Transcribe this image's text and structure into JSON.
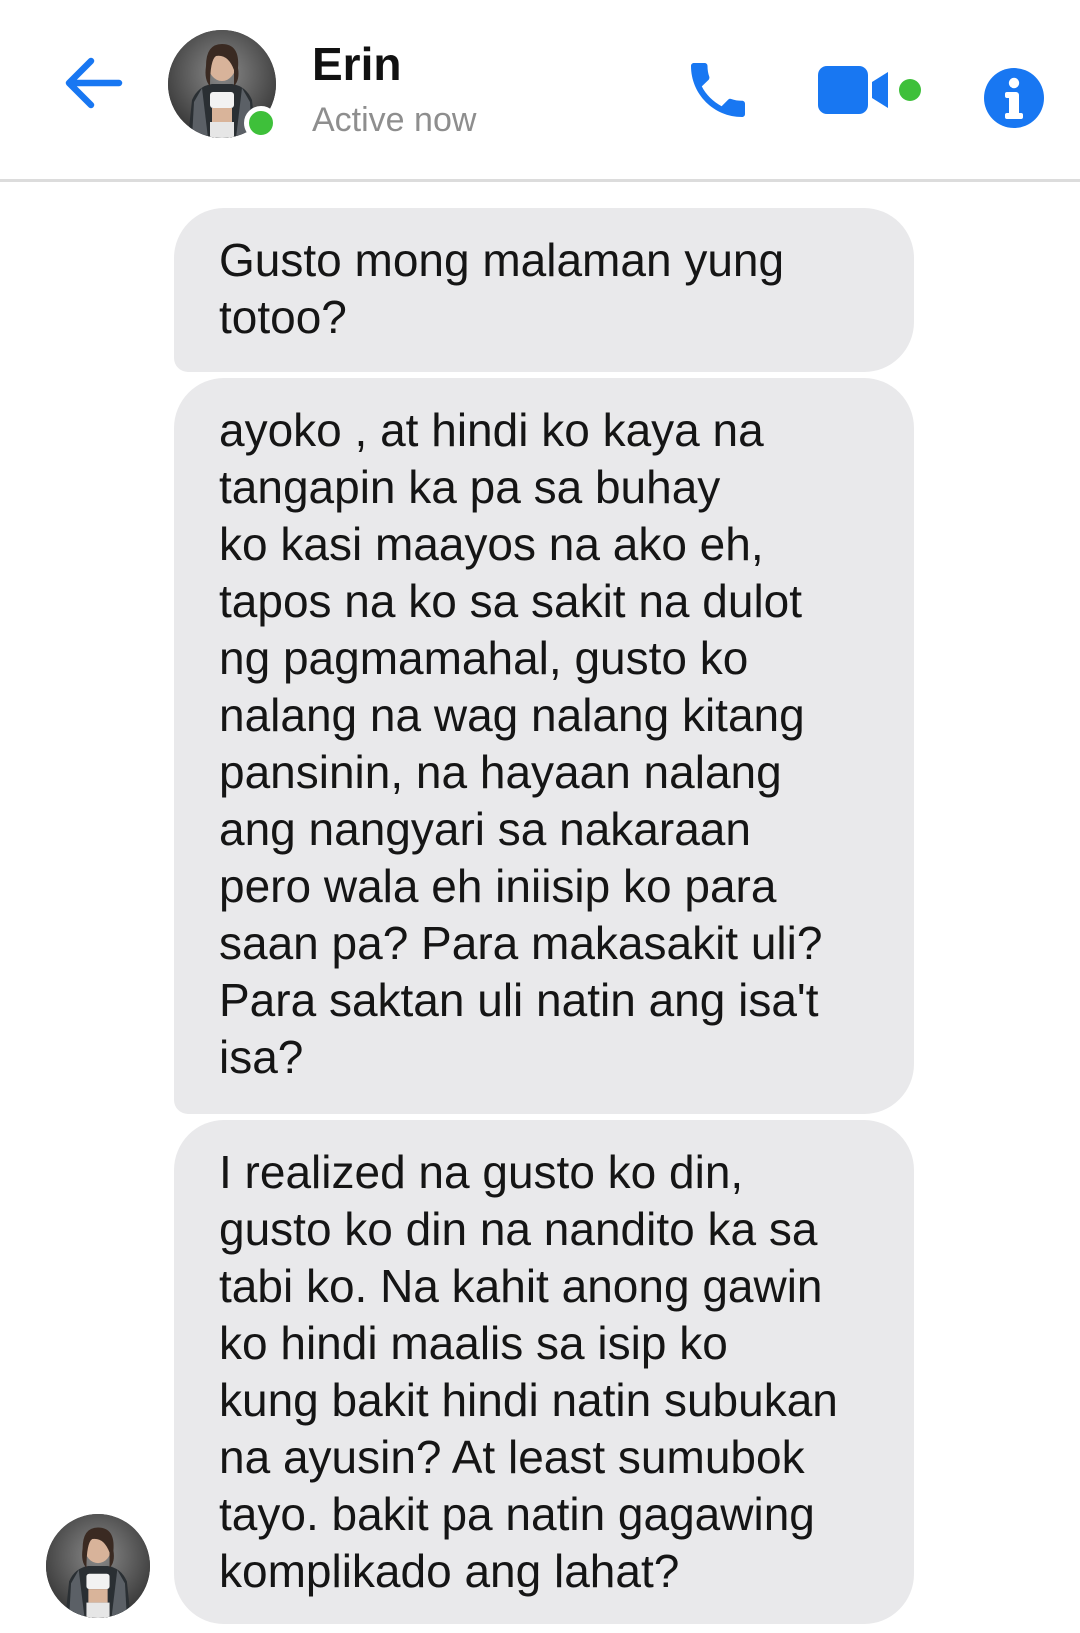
{
  "header": {
    "contact_name": "Erin",
    "status": "Active now",
    "back_icon": "arrow-left-icon",
    "actions": [
      {
        "name": "call",
        "icon": "phone-icon"
      },
      {
        "name": "video-call",
        "icon": "video-camera-icon"
      },
      {
        "name": "info",
        "icon": "info-icon"
      }
    ],
    "accent_color": "#1877f2",
    "online_color": "#3ec03a"
  },
  "thread": {
    "bubble_color": "#e9e9eb",
    "messages": [
      {
        "sender": "Erin",
        "text": "Gusto mong malaman yung\ntotoo?"
      },
      {
        "sender": "Erin",
        "text": "ayoko , at hindi ko kaya na\ntangapin ka pa sa buhay\nko kasi maayos na ako eh,\ntapos na ko sa sakit na dulot\nng pagmamahal, gusto ko\nnalang na wag nalang kitang\npansinin, na hayaan nalang\nang nangyari sa nakaraan\npero wala eh iniisip ko para\nsaan pa? Para makasakit uli?\nPara saktan uli natin ang isa't\nisa?"
      },
      {
        "sender": "Erin",
        "text": "I realized na gusto ko din,\ngusto ko din na nandito ka sa\ntabi ko. Na kahit anong gawin\nko hindi maalis sa isip ko\nkung bakit hindi natin subukan\nna ayusin? At least sumubok\ntayo. bakit pa natin gagawing\nkomplikado ang lahat?"
      }
    ]
  }
}
